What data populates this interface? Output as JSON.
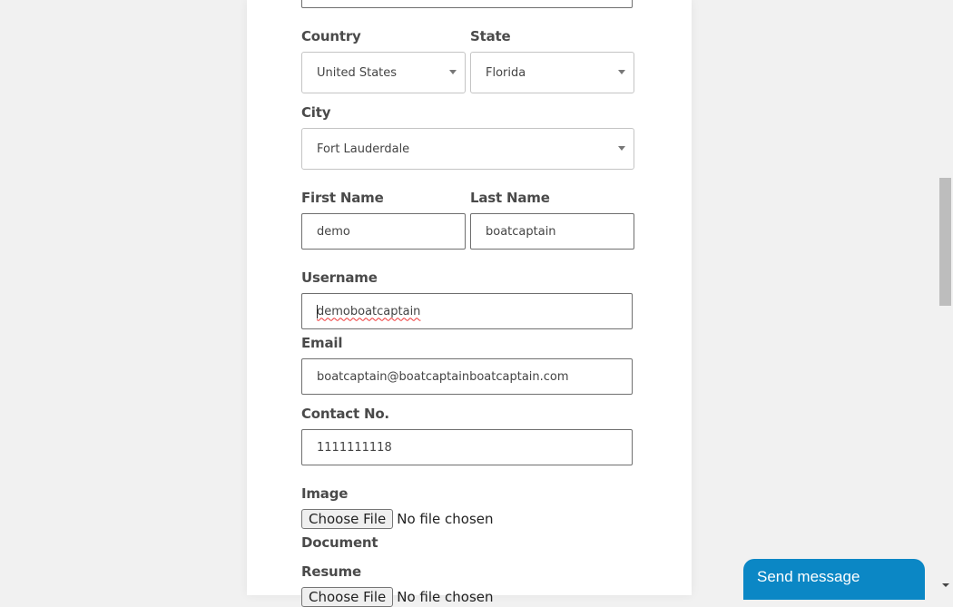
{
  "form": {
    "country": {
      "label": "Country",
      "value": "United States"
    },
    "state": {
      "label": "State",
      "value": "Florida"
    },
    "city": {
      "label": "City",
      "value": "Fort Lauderdale"
    },
    "first_name": {
      "label": "First Name",
      "value": "demo"
    },
    "last_name": {
      "label": "Last Name",
      "value": "boatcaptain"
    },
    "username": {
      "label": "Username",
      "value": "demoboatcaptain"
    },
    "email": {
      "label": "Email",
      "value": "boatcaptain@boatcaptainboatcaptain.com"
    },
    "contact": {
      "label": "Contact No.",
      "value": "1111111118"
    },
    "image": {
      "label": "Image",
      "button": "Choose File",
      "status": "No file chosen"
    },
    "document": {
      "label": "Document"
    },
    "resume": {
      "label": "Resume",
      "button": "Choose File",
      "status": "No file chosen"
    }
  },
  "chat": {
    "label": "Send message",
    "accent": "#0b87c5"
  },
  "icons": {
    "dropdown": "caret-down-icon",
    "chat_toggle": "caret-down-icon"
  }
}
